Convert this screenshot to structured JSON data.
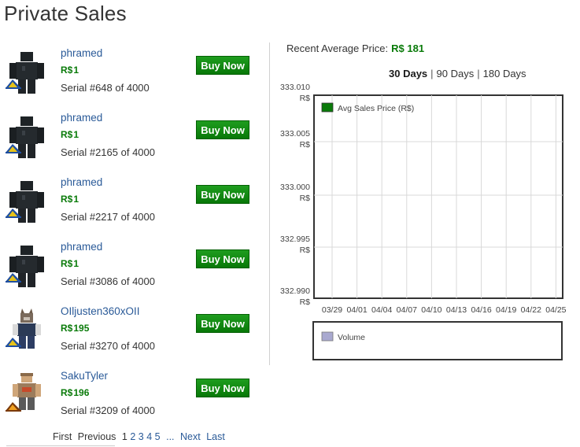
{
  "page_title": "Private Sales",
  "buy_label": "Buy Now",
  "sales": [
    {
      "seller": "phramed",
      "price": "1",
      "serial": "Serial #648 of 4000",
      "avatar": "dark-figure",
      "badge": "builders-club-icon"
    },
    {
      "seller": "phramed",
      "price": "1",
      "serial": "Serial #2165 of 4000",
      "avatar": "dark-figure",
      "badge": "builders-club-icon"
    },
    {
      "seller": "phramed",
      "price": "1",
      "serial": "Serial #2217 of 4000",
      "avatar": "dark-figure",
      "badge": "builders-club-icon"
    },
    {
      "seller": "phramed",
      "price": "1",
      "serial": "Serial #3086 of 4000",
      "avatar": "dark-figure",
      "badge": "builders-club-icon"
    },
    {
      "seller": "OIljusten360xOII",
      "price": "195",
      "serial": "Serial #3270 of 4000",
      "avatar": "wolf-figure",
      "badge": "builders-club-icon"
    },
    {
      "seller": "SakuTyler",
      "price": "196",
      "serial": "Serial #3209 of 4000",
      "avatar": "tan-figure",
      "badge": "outrageous-builders-club-icon"
    }
  ],
  "pager": {
    "first": "First",
    "previous": "Previous",
    "pages": [
      "1",
      "2",
      "3",
      "4",
      "5"
    ],
    "ellipsis": "...",
    "next": "Next",
    "last": "Last"
  },
  "recent_average": {
    "label": "Recent Average Price:",
    "value": "R$ 181"
  },
  "ranges": [
    {
      "label": "30 Days",
      "active": true
    },
    {
      "label": "90 Days",
      "active": false
    },
    {
      "label": "180 Days",
      "active": false
    }
  ],
  "colors": {
    "robux_green": "#0a7b0a",
    "link_blue": "#2a5a98",
    "button_green": "#0f870f",
    "price_series": "#0a7b0a",
    "volume_series": "#a9a9d0"
  },
  "chart_data": {
    "type": "line",
    "y_tick_labels": [
      "333.010",
      "333.005",
      "333.000",
      "332.995",
      "332.990"
    ],
    "y_unit": "R$",
    "ylim": [
      332.99,
      333.01
    ],
    "x_tick_labels": [
      "03/29",
      "04/01",
      "04/04",
      "04/07",
      "04/10",
      "04/13",
      "04/16",
      "04/19",
      "04/22",
      "04/25"
    ],
    "grid": true,
    "legend_placement": "top-left",
    "series": [
      {
        "name": "Avg Sales Price (R$)",
        "values": []
      }
    ],
    "volume_chart": {
      "series": [
        {
          "name": "Volume",
          "values": []
        }
      ]
    }
  }
}
